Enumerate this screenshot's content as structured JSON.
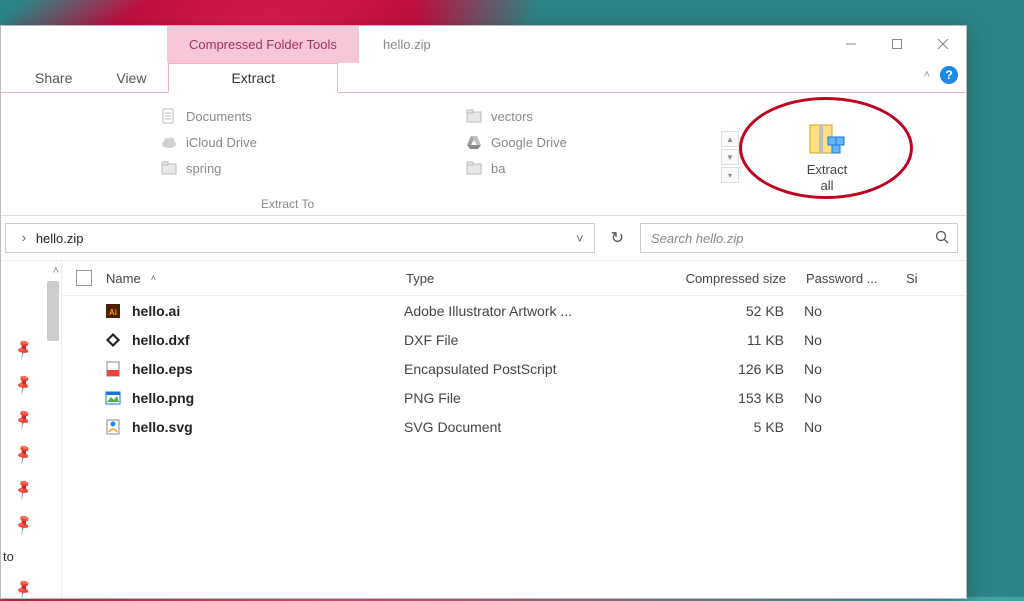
{
  "window": {
    "context_tab": "Compressed Folder Tools",
    "title": "hello.zip"
  },
  "ribbon": {
    "tabs": {
      "share": "Share",
      "view": "View",
      "extract": "Extract"
    },
    "destinations_col1": [
      {
        "label": "Documents",
        "icon": "doc"
      },
      {
        "label": "iCloud Drive",
        "icon": "cloud"
      },
      {
        "label": "spring",
        "icon": "folder"
      }
    ],
    "destinations_col2": [
      {
        "label": "vectors",
        "icon": "folder"
      },
      {
        "label": "Google Drive",
        "icon": "gdrive"
      },
      {
        "label": "ba",
        "icon": "folder"
      }
    ],
    "group_label": "Extract To",
    "extract_all_line1": "Extract",
    "extract_all_line2": "all"
  },
  "address": {
    "path": "hello.zip"
  },
  "search": {
    "placeholder": "Search hello.zip"
  },
  "columns": {
    "name": "Name",
    "type": "Type",
    "compressed": "Compressed size",
    "password": "Password ...",
    "si": "Si"
  },
  "files": [
    {
      "name": "hello.ai",
      "type": "Adobe Illustrator Artwork ...",
      "compressed": "52 KB",
      "password": "No",
      "icon": "ai"
    },
    {
      "name": "hello.dxf",
      "type": "DXF File",
      "compressed": "11 KB",
      "password": "No",
      "icon": "dxf"
    },
    {
      "name": "hello.eps",
      "type": "Encapsulated PostScript",
      "compressed": "126 KB",
      "password": "No",
      "icon": "eps"
    },
    {
      "name": "hello.png",
      "type": "PNG File",
      "compressed": "153 KB",
      "password": "No",
      "icon": "png"
    },
    {
      "name": "hello.svg",
      "type": "SVG Document",
      "compressed": "5 KB",
      "password": "No",
      "icon": "svg"
    }
  ],
  "quick_access": {
    "label_to": "to"
  }
}
